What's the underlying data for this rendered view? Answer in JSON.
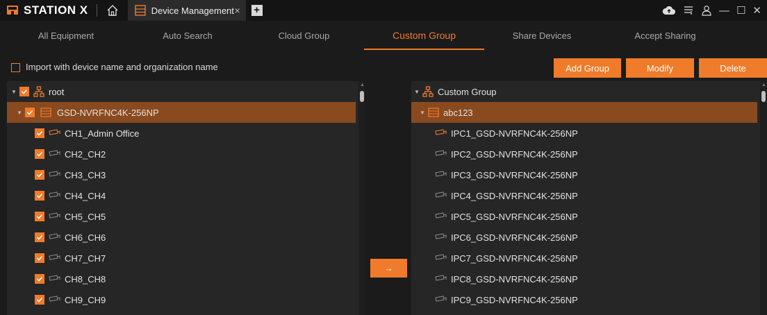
{
  "app": {
    "brand": "STATION X",
    "tab_title": "Device Management",
    "tab_close": "×",
    "add_tab": "+"
  },
  "window_controls": {
    "minimize": "—",
    "maximize": "☐",
    "close": "✕"
  },
  "nav_tabs": [
    {
      "label": "All Equipment",
      "active": false
    },
    {
      "label": "Auto Search",
      "active": false
    },
    {
      "label": "Cloud Group",
      "active": false
    },
    {
      "label": "Custom Group",
      "active": true
    },
    {
      "label": "Share Devices",
      "active": false
    },
    {
      "label": "Accept Sharing",
      "active": false
    }
  ],
  "toolbar": {
    "import_label": "Import with device name and organization name",
    "import_checked": false,
    "add_group": "Add Group",
    "modify": "Modify",
    "delete": "Delete"
  },
  "left_tree": {
    "root_label": "root",
    "device_label": "GSD-NVRFNC4K-256NP",
    "channels": [
      "CH1_Admin Office",
      "CH2_CH2",
      "CH3_CH3",
      "CH4_CH4",
      "CH5_CH5",
      "CH6_CH6",
      "CH7_CH7",
      "CH8_CH8",
      "CH9_CH9"
    ]
  },
  "move_button": "→",
  "right_tree": {
    "root_label": "Custom Group",
    "group_label": "abc123",
    "channels": [
      "IPC1_GSD-NVRFNC4K-256NP",
      "IPC2_GSD-NVRFNC4K-256NP",
      "IPC3_GSD-NVRFNC4K-256NP",
      "IPC4_GSD-NVRFNC4K-256NP",
      "IPC5_GSD-NVRFNC4K-256NP",
      "IPC6_GSD-NVRFNC4K-256NP",
      "IPC7_GSD-NVRFNC4K-256NP",
      "IPC8_GSD-NVRFNC4K-256NP",
      "IPC9_GSD-NVRFNC4K-256NP"
    ]
  },
  "colors": {
    "accent": "#f07b2a",
    "selected_row": "#8a4a1f",
    "panel_bg": "#262626",
    "app_bg": "#1b1b1b"
  }
}
